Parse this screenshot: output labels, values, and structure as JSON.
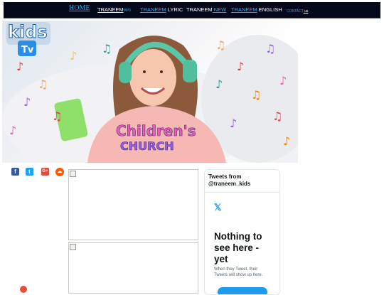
{
  "nav": {
    "home": "HOME",
    "mp3_a": "TRANEEM",
    "mp3_b": "MP3",
    "lyric_a": "TRANEEM",
    "lyric_b": " LYRIC",
    "new_a": "TRANEEM",
    "new_b": " NEW",
    "english_a": "TRANEEM",
    "english_b": " ENGLISH",
    "contact_a": "CONTACT",
    "contact_b": " us"
  },
  "hero": {
    "logo_top": "kids",
    "logo_bottom": "Tv",
    "badge_line1": "Children's",
    "badge_line2": "CHURCH"
  },
  "social": {
    "facebook": "f",
    "twitter": "t",
    "google": "G+",
    "soundcloud": "☁"
  },
  "twitter_widget": {
    "title": "Tweets from @traneem_kids",
    "x_logo": "𝕏",
    "headline": "Nothing to see here - yet",
    "subtext": "When they Tweet, their Tweets will show up here."
  },
  "colors": {
    "nav_bg": "#05071a",
    "link_blue": "#2ba6e0",
    "twitter_blue": "#1d9bf0"
  }
}
